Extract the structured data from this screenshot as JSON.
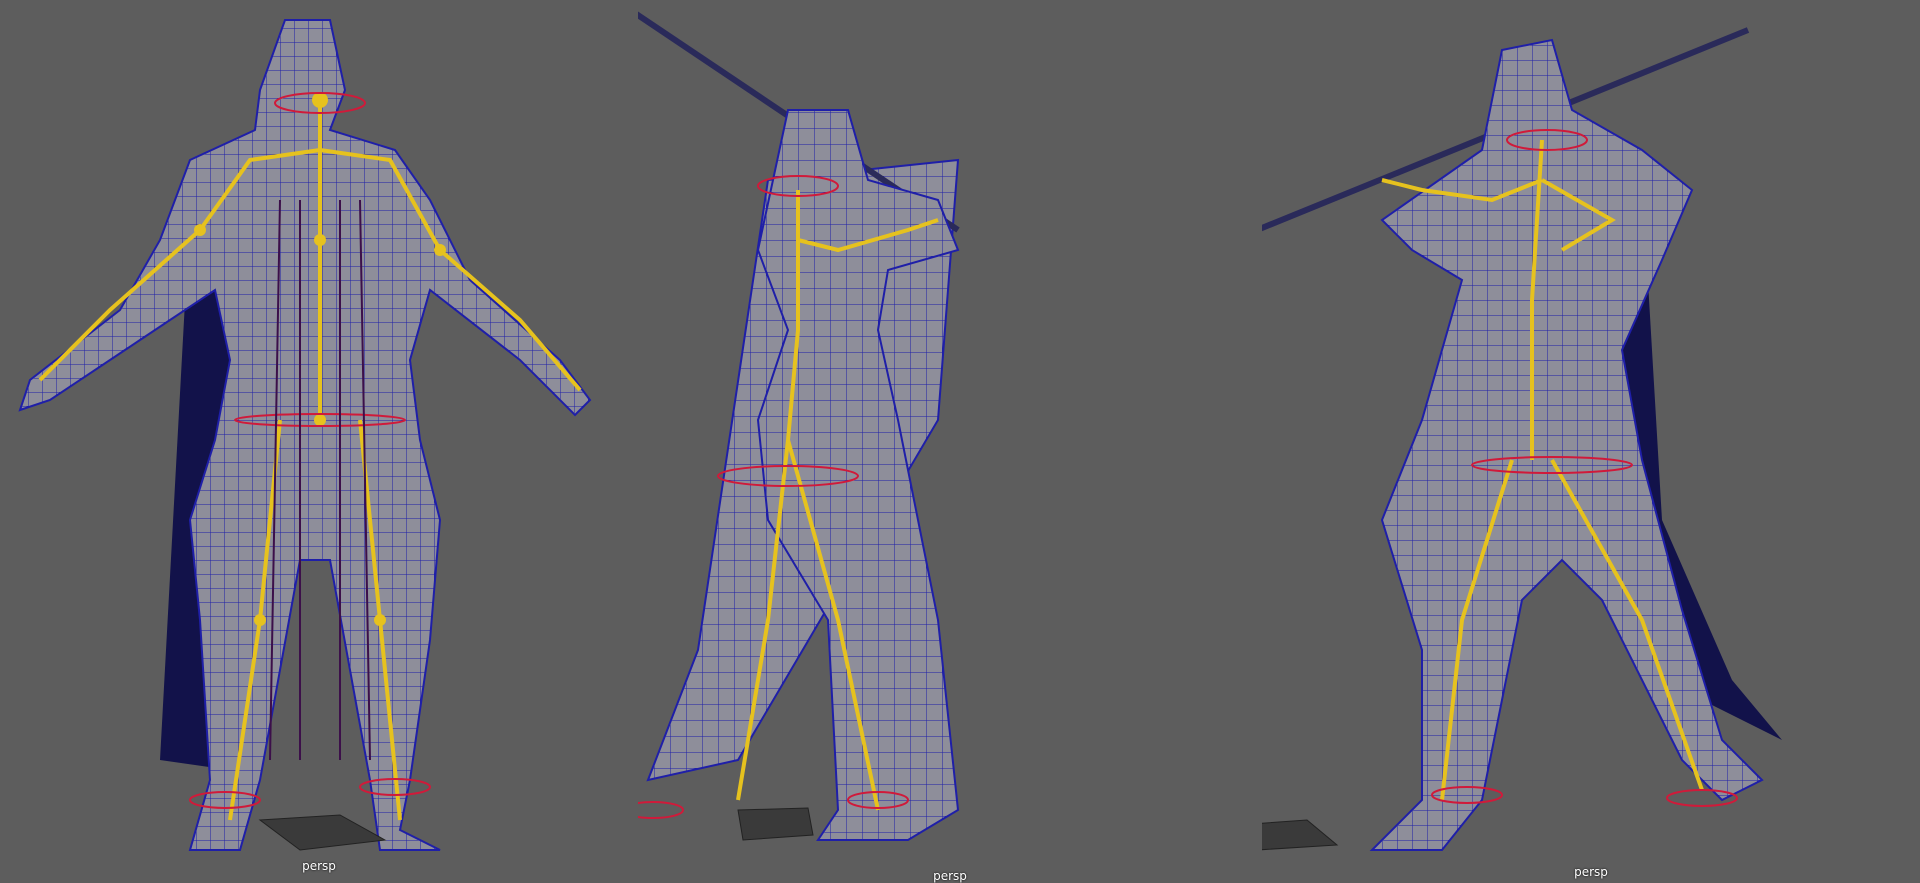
{
  "viewports": [
    {
      "camera": "persp",
      "pose": "a-pose"
    },
    {
      "camera": "persp",
      "pose": "sword-overhead"
    },
    {
      "camera": "persp",
      "pose": "sword-guard"
    }
  ],
  "colors": {
    "background": "#5d5d5d",
    "mesh_fill": "#8e8e9a",
    "wire": "#1f1fa8",
    "joint": "#e6c21e",
    "control": "#d01a3a",
    "influence": "#3c0f4a",
    "cape": "#12124a",
    "grid": "#3a3a3a",
    "label": "#ffffff"
  }
}
